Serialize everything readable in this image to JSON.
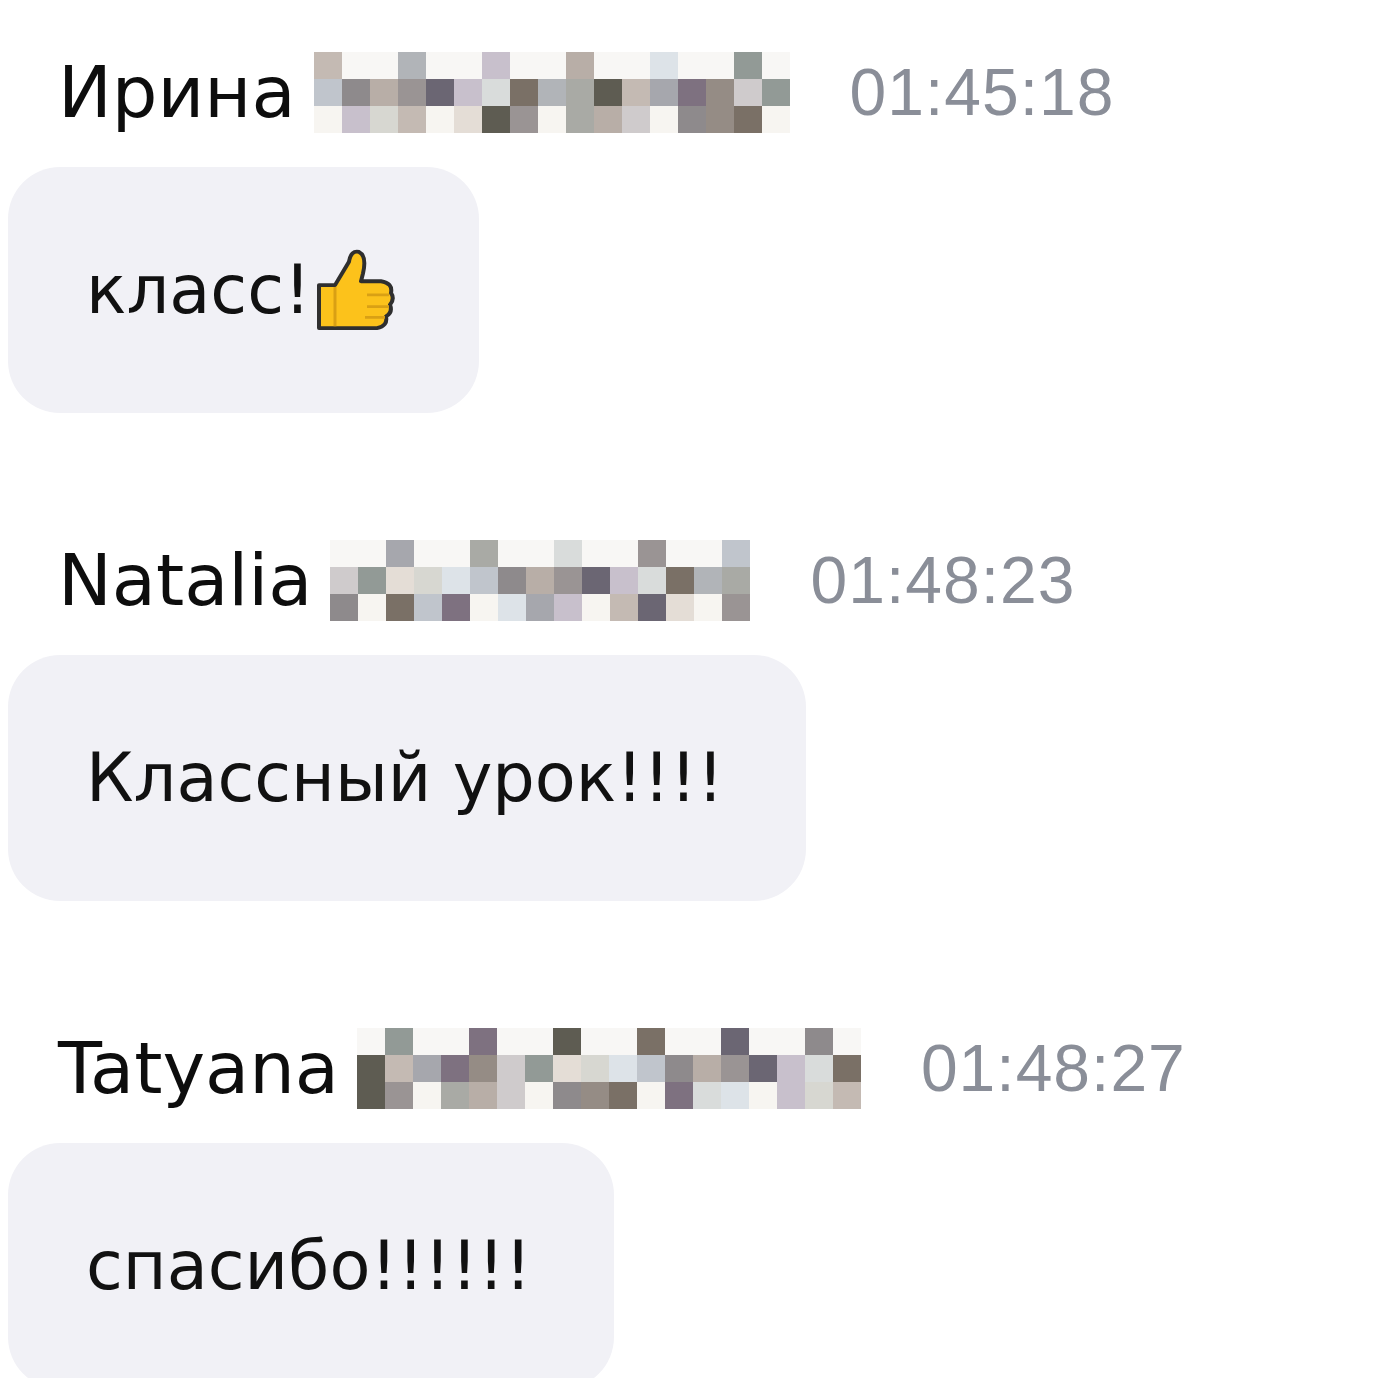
{
  "messages": [
    {
      "author": "Ирина",
      "surname_hidden": true,
      "time": "01:45:18",
      "text": "класс!",
      "emoji": true
    },
    {
      "author": "Natalia",
      "surname_hidden": true,
      "time": "01:48:23",
      "text": "Классный урок!!!!",
      "emoji": false
    },
    {
      "author": "Tatyana",
      "surname_hidden": true,
      "time": "01:48:27",
      "text": "спасибо!!!!!!",
      "emoji": false
    }
  ]
}
